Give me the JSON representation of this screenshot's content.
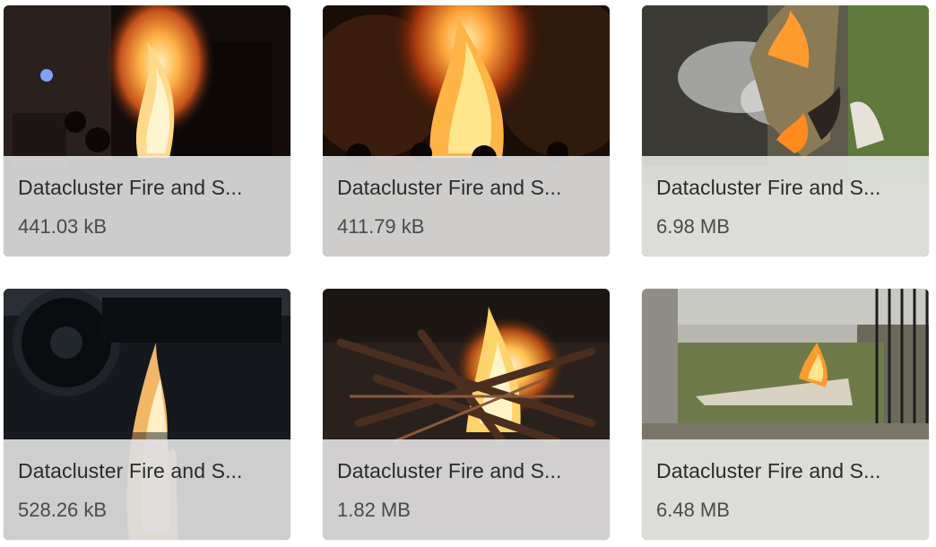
{
  "gallery": {
    "items": [
      {
        "title": "Datacluster Fire and S...",
        "size": "441.03 kB",
        "image": "night-bonfire-crowd"
      },
      {
        "title": "Datacluster Fire and S...",
        "size": "411.79 kB",
        "image": "night-bonfire-trees"
      },
      {
        "title": "Datacluster Fire and S...",
        "size": "6.98 MB",
        "image": "burning-grass-smoke"
      },
      {
        "title": "Datacluster Fire and S...",
        "size": "528.26 kB",
        "image": "flame-near-motorbike"
      },
      {
        "title": "Datacluster Fire and S...",
        "size": "1.82 MB",
        "image": "campfire-wood-logs"
      },
      {
        "title": "Datacluster Fire and S...",
        "size": "6.48 MB",
        "image": "trash-fire-yard"
      }
    ]
  }
}
